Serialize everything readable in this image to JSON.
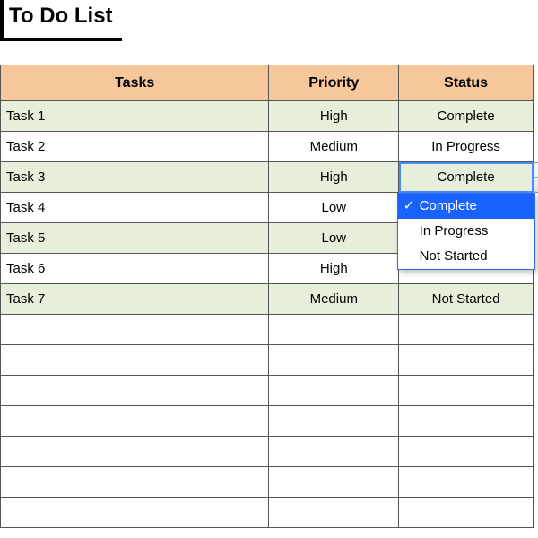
{
  "title": "To Do List",
  "columns": {
    "tasks": "Tasks",
    "priority": "Priority",
    "status": "Status"
  },
  "rows": [
    {
      "task": "Task 1",
      "priority": "High",
      "status": "Complete"
    },
    {
      "task": "Task 2",
      "priority": "Medium",
      "status": "In Progress"
    },
    {
      "task": "Task 3",
      "priority": "High",
      "status": "Complete"
    },
    {
      "task": "Task 4",
      "priority": "Low",
      "status": ""
    },
    {
      "task": "Task 5",
      "priority": "Low",
      "status": ""
    },
    {
      "task": "Task 6",
      "priority": "High",
      "status": ""
    },
    {
      "task": "Task 7",
      "priority": "Medium",
      "status": "Not Started"
    }
  ],
  "empty_row_count": 7,
  "active_row_index": 2,
  "dropdown": {
    "options": [
      "Complete",
      "In Progress",
      "Not Started"
    ],
    "selected_index": 0
  }
}
